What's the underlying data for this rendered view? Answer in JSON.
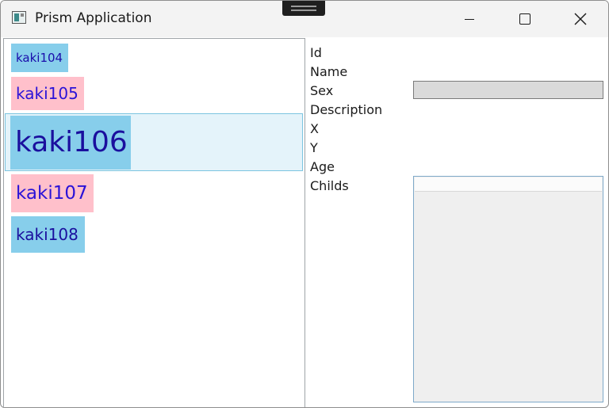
{
  "window": {
    "title": "Prism Application",
    "icons": {
      "app": "app-window-icon",
      "minimize": "minimize-icon",
      "maximize": "maximize-icon",
      "close": "close-icon"
    }
  },
  "list": {
    "items": [
      {
        "label": "kaki104",
        "color": "#87ceeb"
      },
      {
        "label": "kaki105",
        "color": "#ffc0cb"
      },
      {
        "label": "kaki106",
        "color": "#87ceeb",
        "selected": true
      },
      {
        "label": "kaki107",
        "color": "#ffc0cb"
      },
      {
        "label": "kaki108",
        "color": "#87ceeb"
      }
    ]
  },
  "detail": {
    "labels": {
      "id": "Id",
      "name": "Name",
      "sex": "Sex",
      "description": "Description",
      "x": "X",
      "y": "Y",
      "age": "Age",
      "childs": "Childs"
    },
    "sex_value": "",
    "childs": []
  },
  "colors": {
    "selected_row_bg": "#e4f3fa",
    "selected_row_border": "#7cc5e0",
    "item_text": "#1a0dab"
  }
}
